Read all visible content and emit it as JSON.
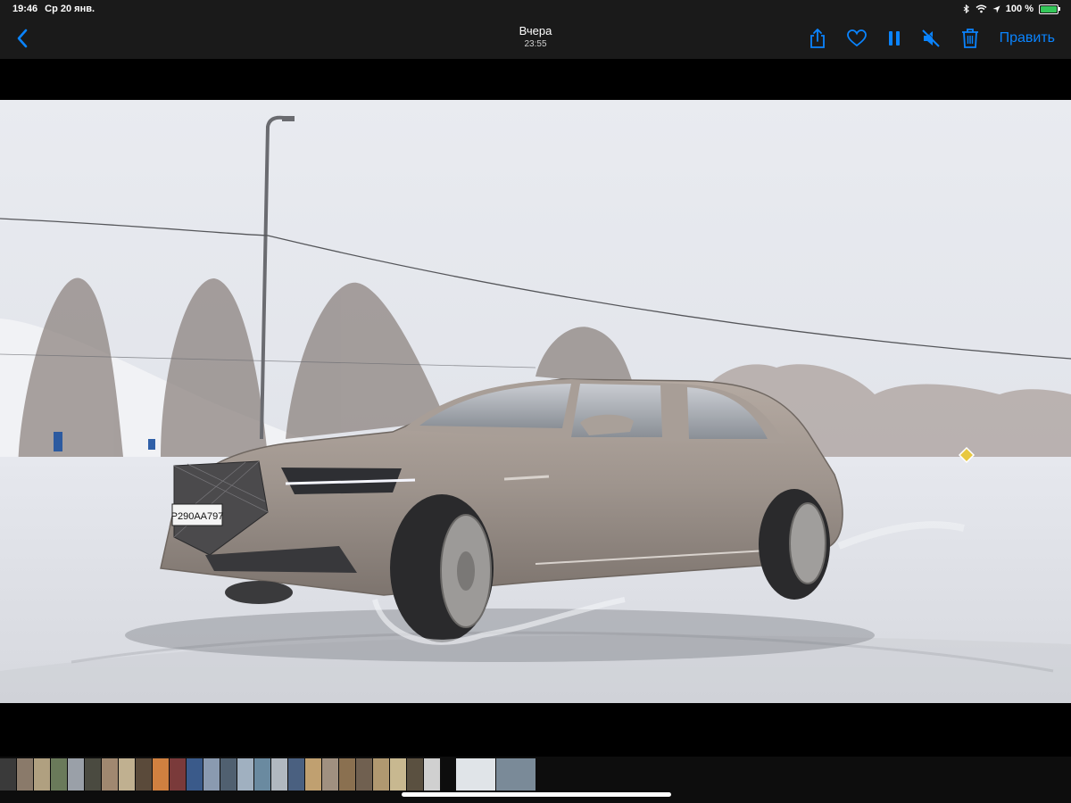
{
  "status": {
    "time": "19:46",
    "date": "Ср 20 янв.",
    "battery_text": "100 %"
  },
  "header": {
    "title": "Вчера",
    "subtitle": "23:55",
    "edit_label": "Править"
  },
  "photo": {
    "plate_text": "Р290АА797",
    "sign_color": "#e8c840"
  },
  "thumbnails": {
    "colors": [
      "#3a3a3a",
      "#8a7a6a",
      "#b0a080",
      "#6a7a5a",
      "#9aa0a8",
      "#4a4a40",
      "#a08870",
      "#c0b090",
      "#5a4a3a",
      "#d08040",
      "#7a3a3a",
      "#3a5a8a",
      "#8a9ab0",
      "#506070",
      "#a0b0c0",
      "#6a8aa0",
      "#b0b8c0",
      "#4a6080",
      "#c0a070",
      "#a09080",
      "#8a7050",
      "#706050",
      "#b09870",
      "#c8b890",
      "#5a5040",
      "#d0d0d0"
    ],
    "selected_colors": [
      "#e0e4e8",
      "#7a8a98"
    ]
  }
}
